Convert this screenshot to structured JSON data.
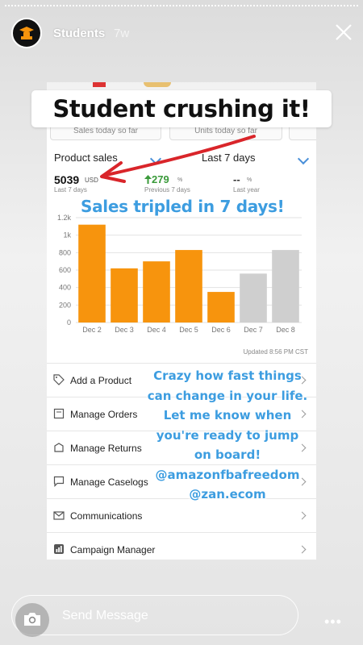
{
  "header": {
    "username": "Students",
    "time": "7w"
  },
  "captions": {
    "headline": "Student crushing it!",
    "sales_tripled": "Sales tripled in 7 days!",
    "crazy_lines": [
      "Crazy how fast things",
      "can change in your life.",
      "Let me know when",
      "you're ready to jump",
      "on board!"
    ],
    "handles": [
      "@amazonfbafreedom",
      "@zan.ecom"
    ]
  },
  "screenshot": {
    "summary": {
      "left": "Sales today so far",
      "right": "Units today so far"
    },
    "selector_left": "Product sales",
    "selector_right": "Last 7 days",
    "stats": {
      "value": "5039",
      "unit": "USD",
      "value_label": "Last 7 days",
      "change": "279",
      "change_suffix": "%",
      "change_label": "Previous 7 days",
      "last_year": "--",
      "last_year_suffix": "%",
      "last_year_label": "Last year"
    },
    "updated": "Updated 8:56 PM CST",
    "menu": [
      {
        "label": "Add a Product",
        "icon": "tag-icon"
      },
      {
        "label": "Manage Orders",
        "icon": "orders-icon"
      },
      {
        "label": "Manage Returns",
        "icon": "returns-icon"
      },
      {
        "label": "Manage Caselogs",
        "icon": "chat-icon"
      },
      {
        "label": "Communications",
        "icon": "messages-icon"
      },
      {
        "label": "Campaign Manager",
        "icon": "campaign-icon"
      }
    ]
  },
  "chart_data": {
    "type": "bar",
    "categories": [
      "Dec 2",
      "Dec 3",
      "Dec 4",
      "Dec 5",
      "Dec 6",
      "Dec 7",
      "Dec 8"
    ],
    "values": [
      1120,
      620,
      700,
      830,
      350,
      560,
      830
    ],
    "colors": [
      "#f7940d",
      "#f7940d",
      "#f7940d",
      "#f7940d",
      "#f7940d",
      "#cfcfcf",
      "#cfcfcf"
    ],
    "yticks": [
      0,
      200,
      400,
      600,
      800,
      1000,
      1200
    ],
    "ytick_labels": [
      "0",
      "200",
      "400",
      "600",
      "800",
      "1k",
      "1.2k"
    ],
    "ylim": [
      0,
      1200
    ],
    "grid": true
  },
  "bottom": {
    "placeholder": "Send Message",
    "more": "•••"
  },
  "colors": {
    "accent": "#3d9de0",
    "bar_active": "#f7940d",
    "bar_future": "#cfcfcf",
    "arrow": "#d9252a",
    "up": "#3a9a3a"
  }
}
